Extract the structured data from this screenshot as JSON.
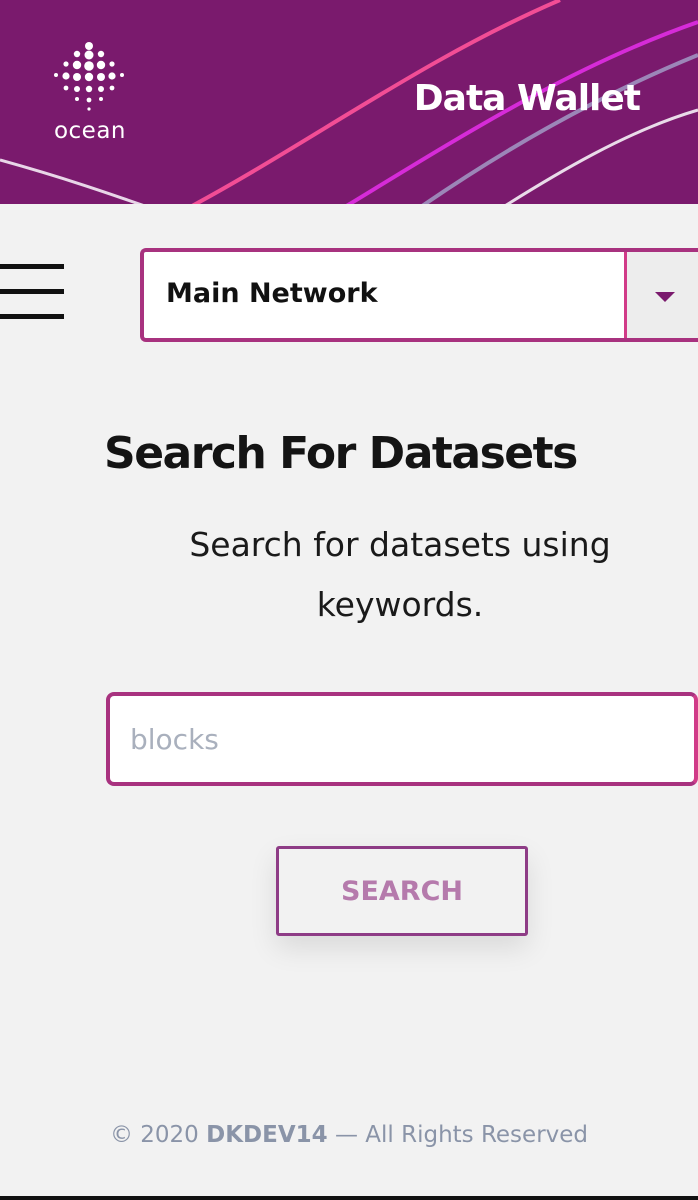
{
  "header": {
    "logo_text": "ocean",
    "title": "Data Wallet",
    "background_color": "#7a1a6d"
  },
  "toolbar": {
    "menu_icon": "hamburger-menu-icon",
    "network_select": {
      "value": "Main Network",
      "caret_icon": "triangle-down-icon"
    }
  },
  "main": {
    "title": "Search For Datasets",
    "subtitle": "Search for datasets using keywords.",
    "search": {
      "value": "",
      "placeholder": "blocks"
    },
    "search_button_label": "SEARCH"
  },
  "footer": {
    "prefix": "© 2020 ",
    "author": "DKDEV14",
    "suffix": " — All Rights Reserved"
  },
  "colors": {
    "brand_purple": "#7a1a6d",
    "accent_pink": "#d13b88",
    "button_text": "#b57aac",
    "footer_text": "#8a94a8"
  }
}
